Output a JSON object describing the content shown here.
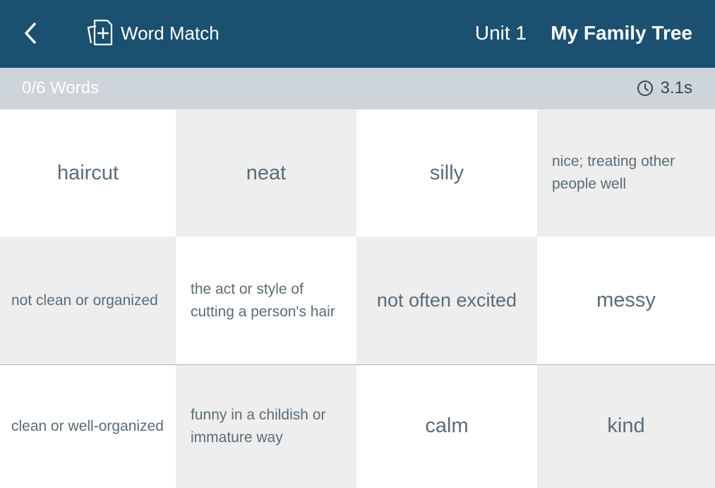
{
  "header": {
    "app_title": "Word Match",
    "unit_label": "Unit 1",
    "unit_title": "My Family Tree"
  },
  "status": {
    "progress": "0/6 Words",
    "timer": "3.1s"
  },
  "colors": {
    "header_bg": "#1b5070",
    "subbar_bg": "#ced5da",
    "card_grey": "#eeeeee",
    "card_white": "#ffffff",
    "card_text": "#5a6c78"
  },
  "icons": {
    "back": "chevron-left-icon",
    "app": "add-card-icon",
    "timer": "clock-icon"
  },
  "cards": [
    [
      "haircut",
      "neat",
      "silly",
      "nice; treating other people well"
    ],
    [
      "not clean or organized",
      "the act or style of cutting a person's hair",
      "not often excited",
      "messy"
    ],
    [
      "clean or well-organized",
      "funny in a childish or immature way",
      "calm",
      "kind"
    ]
  ]
}
